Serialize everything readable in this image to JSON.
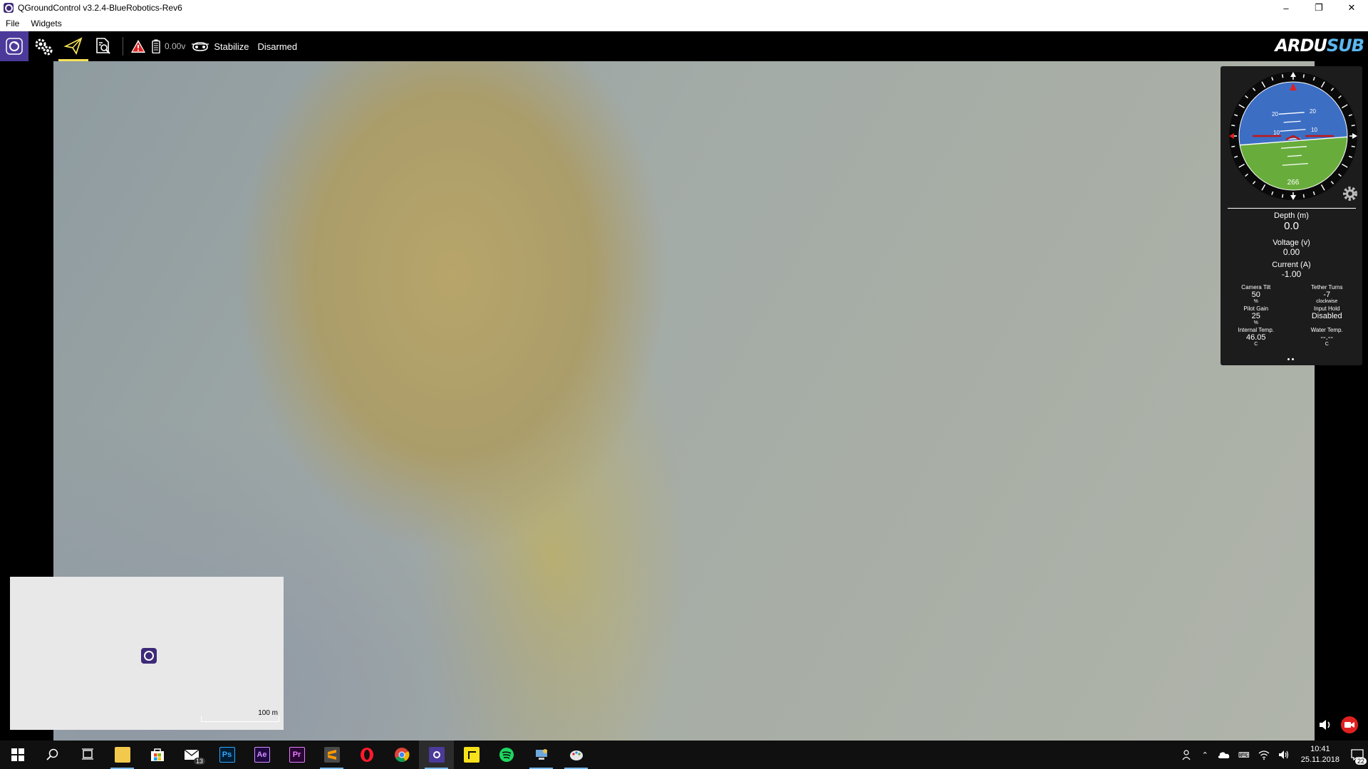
{
  "window": {
    "title": "QGroundControl v3.2.4-BlueRobotics-Rev6",
    "minimize": "–",
    "restore": "❐",
    "close": "✕"
  },
  "menu": {
    "items": [
      "File",
      "Widgets"
    ]
  },
  "toolbar": {
    "battery_voltage": "0.00v",
    "flight_mode": "Stabilize",
    "arm_state": "Disarmed",
    "logo_text_a": "ARDU",
    "logo_text_b": "SUB",
    "icons": [
      "qgc-home-icon",
      "gears-icon",
      "paper-plane-icon",
      "analyze-icon",
      "warning-icon",
      "battery-icon",
      "vehicle-icon"
    ],
    "accent_color": "#f5e257"
  },
  "attitude": {
    "heading": "266",
    "pitch_labels": [
      "20",
      "20",
      "10",
      "10"
    ]
  },
  "instruments": {
    "depth_label": "Depth (m)",
    "depth_value": "0.0",
    "voltage_label": "Voltage (v)",
    "voltage_value": "0.00",
    "current_label": "Current (A)",
    "current_value": "-1.00",
    "mini": [
      {
        "label": "Camera Tilt",
        "value": "50",
        "unit": "%"
      },
      {
        "label": "Tether Turns",
        "value": "-7",
        "unit": "clockwise"
      },
      {
        "label": "Pilot Gain",
        "value": "25",
        "unit": "%"
      },
      {
        "label": "Input Hold",
        "value": "Disabled",
        "unit": ""
      },
      {
        "label": "Internal Temp.",
        "value": "46.05",
        "unit": "C"
      },
      {
        "label": "Water Temp.",
        "value": "--.--",
        "unit": "C"
      }
    ]
  },
  "map": {
    "scale_label": "100 m"
  },
  "taskbar": {
    "apps": [
      "windows-start-icon",
      "search-icon",
      "task-view-icon",
      "file-explorer-icon",
      "store-icon",
      "mail-icon",
      "photoshop-icon",
      "after-effects-icon",
      "premiere-icon",
      "sublime-text-icon",
      "opera-icon",
      "chrome-icon",
      "qgroundcontrol-icon",
      "sticky-notes-icon",
      "spotify-icon",
      "network-tool-icon",
      "paint-icon"
    ],
    "mail_badge": "13",
    "ps_label": "Ps",
    "ae_label": "Ae",
    "pr_label": "Pr",
    "time": "10:41",
    "date": "25.11.2018",
    "notification_count": "22"
  }
}
